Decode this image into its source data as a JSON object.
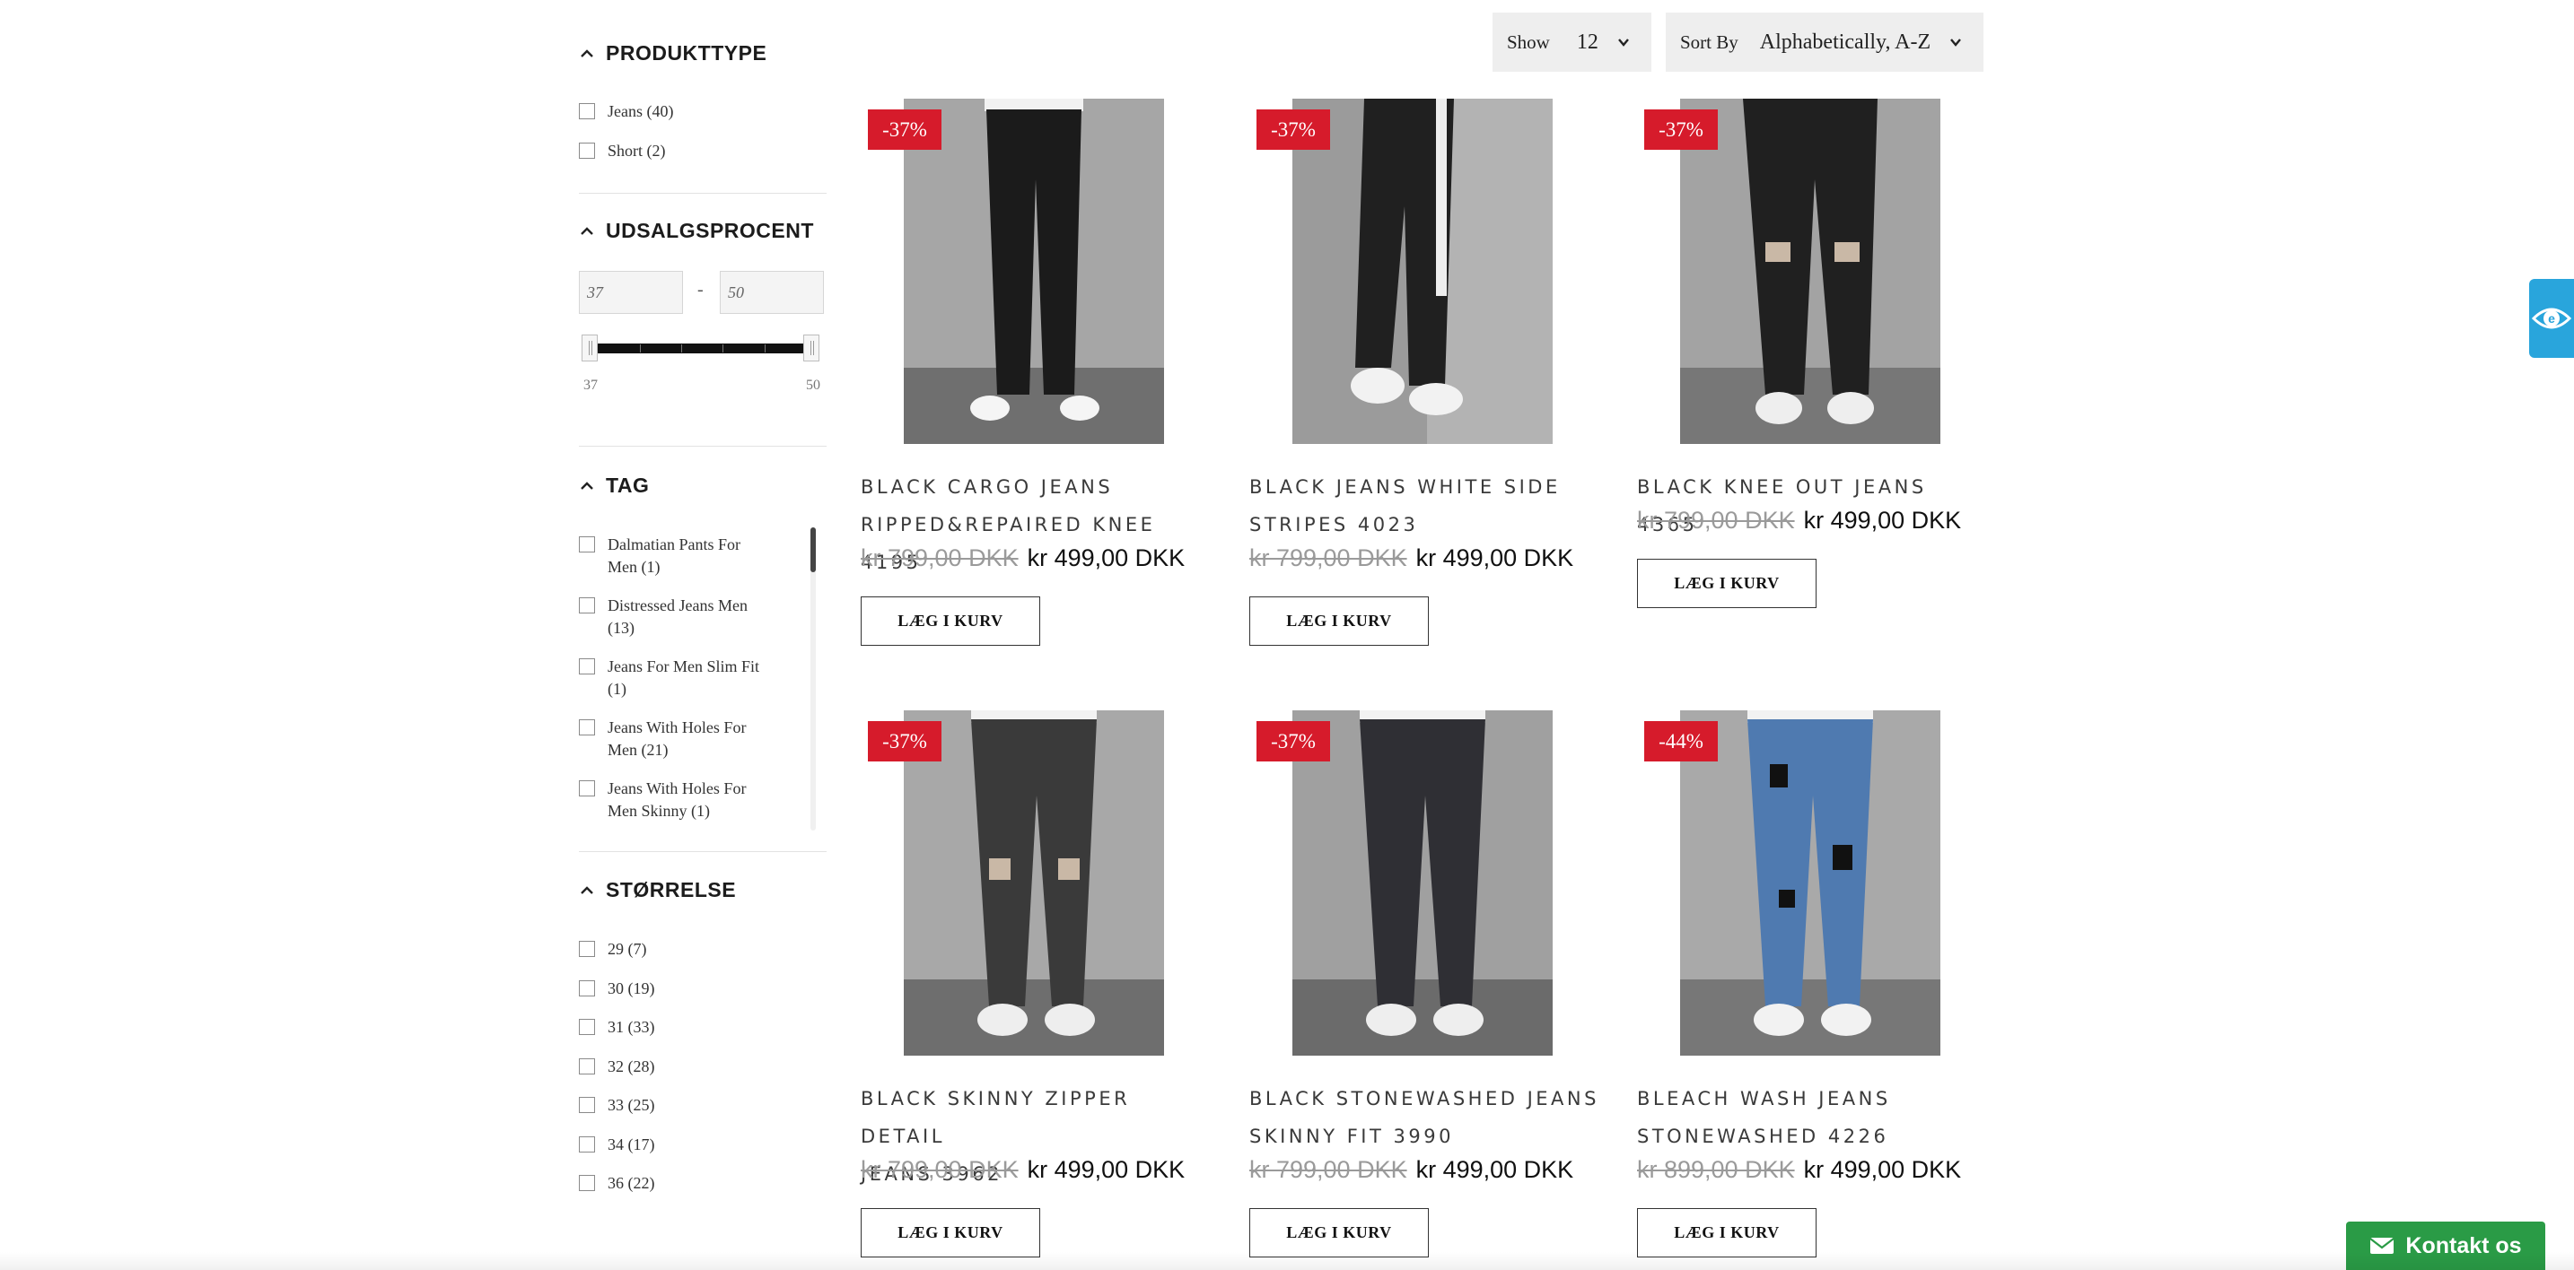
{
  "filters": {
    "product_type": {
      "heading": "PRODUKTTYPE",
      "options": [
        {
          "label": "Jeans (40)"
        },
        {
          "label": "Short (2)"
        }
      ]
    },
    "discount": {
      "heading": "UDSALGSPROCENT",
      "min_value": "37",
      "max_value": "50",
      "min_label": "37",
      "max_label": "50",
      "dash": "-"
    },
    "tag": {
      "heading": "TAG",
      "options": [
        {
          "line1": "Dalmatian Pants For",
          "line2": "Men (1)"
        },
        {
          "line1": "Distressed Jeans Men",
          "line2": "(13)"
        },
        {
          "line1": "Jeans For Men Slim Fit",
          "line2": "(1)"
        },
        {
          "line1": "Jeans With Holes For",
          "line2": "Men (21)"
        },
        {
          "line1": "Jeans With Holes For",
          "line2": "Men Skinny (1)"
        }
      ]
    },
    "size": {
      "heading": "STØRRELSE",
      "options": [
        {
          "label": "29 (7)"
        },
        {
          "label": "30 (19)"
        },
        {
          "label": "31 (33)"
        },
        {
          "label": "32 (28)"
        },
        {
          "label": "33 (25)"
        },
        {
          "label": "34 (17)"
        },
        {
          "label": "36 (22)"
        }
      ]
    }
  },
  "toolbar": {
    "show_label": "Show",
    "show_value": "12",
    "sort_label": "Sort By",
    "sort_value": "Alphabetically, A-Z"
  },
  "products": [
    {
      "badge": "-37%",
      "title_line1": "BLACK CARGO JEANS",
      "title_line2": "RIPPED&REPAIRED KNEE 4195",
      "old_price": "kr 799,00 DKK",
      "new_price": "kr 499,00 DKK",
      "button": "LÆG I KURV"
    },
    {
      "badge": "-37%",
      "title_line1": "BLACK JEANS WHITE SIDE",
      "title_line2": "STRIPES 4023",
      "old_price": "kr 799,00 DKK",
      "new_price": "kr 499,00 DKK",
      "button": "LÆG I KURV"
    },
    {
      "badge": "-37%",
      "title_line1": "BLACK KNEE OUT JEANS 4365",
      "title_line2": "",
      "old_price": "kr 799,00 DKK",
      "new_price": "kr 499,00 DKK",
      "button": "LÆG I KURV"
    },
    {
      "badge": "-37%",
      "title_line1": "BLACK SKINNY ZIPPER DETAIL",
      "title_line2": "JEANS 3962",
      "old_price": "kr 799,00 DKK",
      "new_price": "kr 499,00 DKK",
      "button": "LÆG I KURV"
    },
    {
      "badge": "-37%",
      "title_line1": "BLACK STONEWASHED JEANS",
      "title_line2": "SKINNY FIT 3990",
      "old_price": "kr 799,00 DKK",
      "new_price": "kr 499,00 DKK",
      "button": "LÆG I KURV"
    },
    {
      "badge": "-44%",
      "title_line1": "BLEACH WASH JEANS",
      "title_line2": "STONEWASHED 4226",
      "old_price": "kr 899,00 DKK",
      "new_price": "kr 499,00 DKK",
      "button": "LÆG I KURV"
    }
  ],
  "contact": {
    "label": "Kontakt os",
    "icon": "envelope-icon"
  },
  "widgets": {
    "accessibility_icon": "eye-icon"
  },
  "colors": {
    "badge_red": "#d61b2b",
    "contact_green": "#2a9b46",
    "widget_blue": "#29a5dc"
  }
}
